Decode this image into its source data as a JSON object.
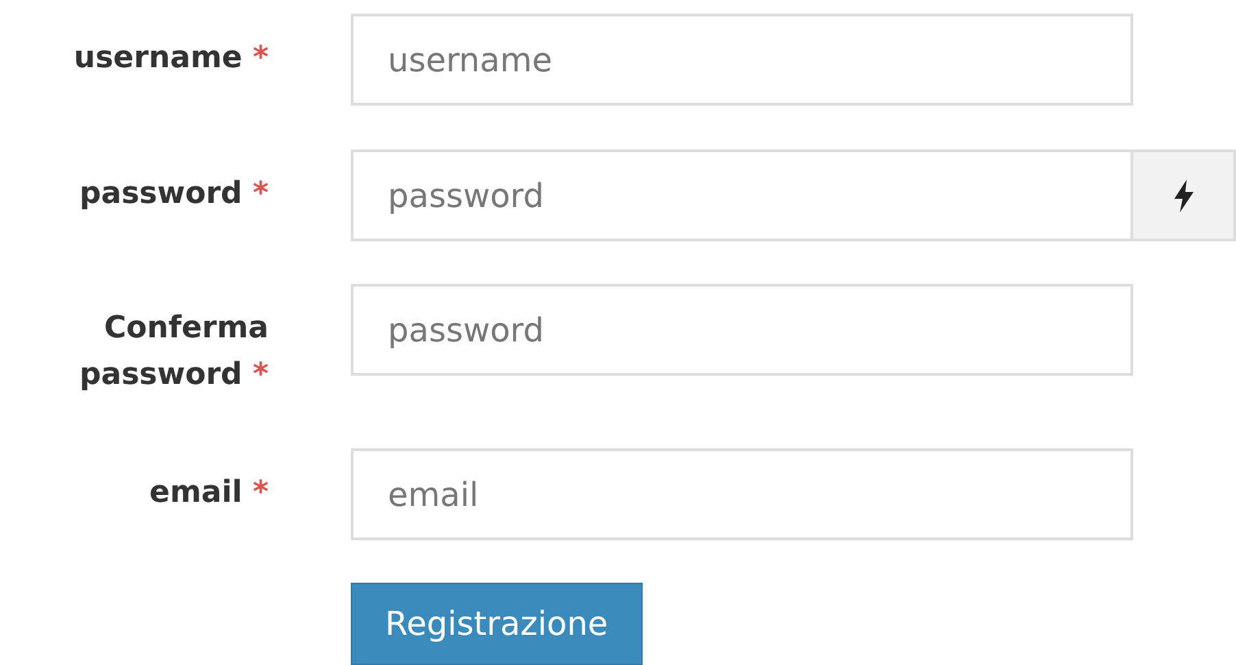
{
  "fields": [
    {
      "label": "username",
      "required_mark": "*",
      "placeholder": "username",
      "kind": "plain"
    },
    {
      "label": "password",
      "required_mark": "*",
      "placeholder": "password",
      "kind": "generator"
    },
    {
      "label": "Conferma password",
      "required_mark": "*",
      "placeholder": "password",
      "kind": "plain"
    },
    {
      "label": "email",
      "required_mark": "*",
      "placeholder": "email",
      "kind": "plain"
    }
  ],
  "submit": {
    "label": "Registrazione"
  }
}
